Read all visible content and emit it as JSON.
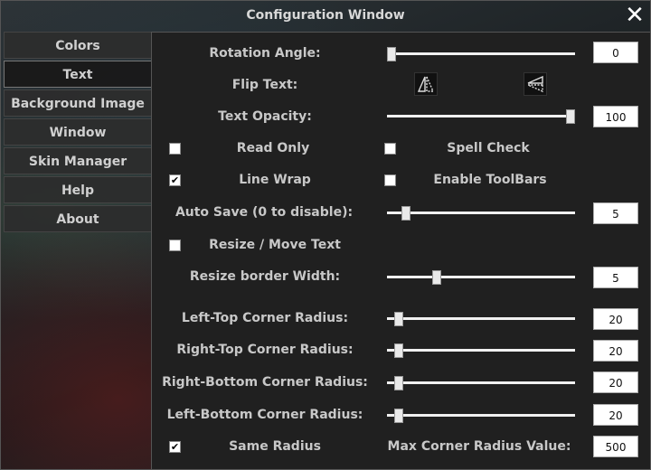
{
  "window": {
    "title": "Configuration Window",
    "close_glyph": "✕"
  },
  "sidebar": {
    "tabs": [
      {
        "label": "Colors",
        "active": false
      },
      {
        "label": "Text",
        "active": true
      },
      {
        "label": "Background Image",
        "active": false
      },
      {
        "label": "Window",
        "active": false
      },
      {
        "label": "Skin Manager",
        "active": false
      },
      {
        "label": "Help",
        "active": false
      },
      {
        "label": "About",
        "active": false
      }
    ]
  },
  "text": {
    "rotation": {
      "label": "Rotation Angle:",
      "value": "0",
      "fraction": 0.0
    },
    "flip": {
      "label": "Flip Text:",
      "horizontal_icon": "flip-horizontal-icon",
      "vertical_icon": "flip-vertical-icon"
    },
    "opacity": {
      "label": "Text Opacity:",
      "value": "100",
      "fraction": 1.0
    },
    "read_only": {
      "label": "Read Only",
      "checked": false
    },
    "spell_check": {
      "label": "Spell Check",
      "checked": false
    },
    "line_wrap": {
      "label": "Line Wrap",
      "checked": true
    },
    "toolbars": {
      "label": "Enable ToolBars",
      "checked": false
    },
    "autosave": {
      "label": "Auto Save (0 to disable):",
      "value": "5",
      "fraction": 0.08
    },
    "resize_move": {
      "label": "Resize / Move Text",
      "checked": false
    },
    "border_width": {
      "label": "Resize border Width:",
      "value": "5",
      "fraction": 0.25
    },
    "left_top": {
      "label": "Left-Top Corner Radius:",
      "value": "20",
      "fraction": 0.04
    },
    "right_top": {
      "label": "Right-Top Corner Radius:",
      "value": "20",
      "fraction": 0.04
    },
    "right_bottom": {
      "label": "Right-Bottom Corner Radius:",
      "value": "20",
      "fraction": 0.04
    },
    "left_bottom": {
      "label": "Left-Bottom Corner Radius:",
      "value": "20",
      "fraction": 0.04
    },
    "same_radius": {
      "label": "Same Radius",
      "checked": true
    },
    "max_radius": {
      "label": "Max Corner Radius Value:",
      "value": "500"
    }
  },
  "colors": {
    "panel": "#202020",
    "track": "#f0f0f0"
  }
}
